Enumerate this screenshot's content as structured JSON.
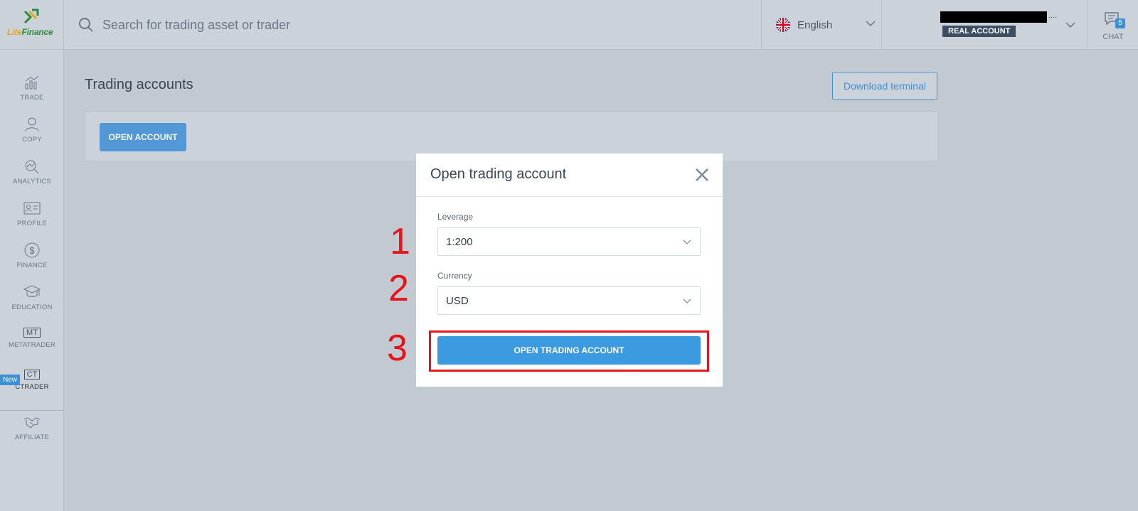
{
  "brand": {
    "lite": "Lite",
    "finance": "Finance"
  },
  "search": {
    "placeholder": "Search for trading asset or trader"
  },
  "language": {
    "label": "English"
  },
  "account": {
    "badge": "REAL ACCOUNT",
    "dots": "...."
  },
  "chat": {
    "label": "CHAT",
    "count": "5"
  },
  "sidebar": {
    "items": [
      {
        "label": "TRADE",
        "icon": "chart-icon"
      },
      {
        "label": "COPY",
        "icon": "user-icon"
      },
      {
        "label": "ANALYTICS",
        "icon": "analytics-icon"
      },
      {
        "label": "PROFILE",
        "icon": "id-card-icon"
      },
      {
        "label": "FINANCE",
        "icon": "dollar-icon"
      },
      {
        "label": "EDUCATION",
        "icon": "graduation-cap-icon"
      },
      {
        "label": "METATRADER",
        "tag": "MT"
      },
      {
        "label": "CTRADER",
        "tag": "CT",
        "new": "New"
      },
      {
        "label": "AFFILIATE",
        "icon": "handshake-icon"
      }
    ]
  },
  "main": {
    "title": "Trading accounts",
    "download_label": "Download terminal",
    "open_account_label": "OPEN ACCOUNT"
  },
  "modal": {
    "title": "Open trading account",
    "leverage_label": "Leverage",
    "leverage_value": "1:200",
    "currency_label": "Currency",
    "currency_value": "USD",
    "submit_label": "OPEN TRADING ACCOUNT"
  },
  "steps": [
    "1",
    "2",
    "3"
  ],
  "colors": {
    "accent": "#3d8fd6",
    "highlight": "#e8141c"
  }
}
